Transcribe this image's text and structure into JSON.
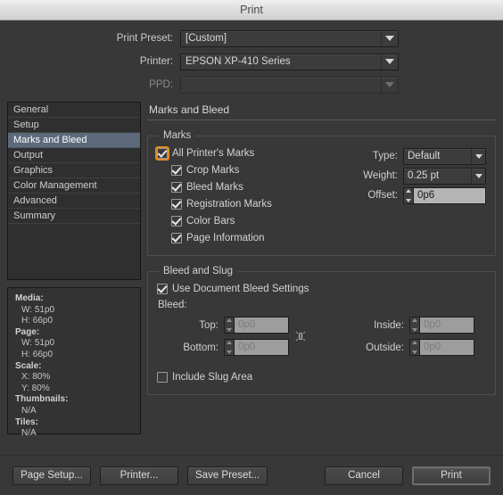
{
  "window": {
    "title": "Print"
  },
  "top_form": {
    "rows": [
      {
        "label": "Print Preset:",
        "value": "[Custom]",
        "disabled": false
      },
      {
        "label": "Printer:",
        "value": "EPSON XP-410 Series",
        "disabled": false
      },
      {
        "label": "PPD:",
        "value": "",
        "disabled": true
      }
    ]
  },
  "sidebar": {
    "items": [
      {
        "label": "General",
        "selected": false
      },
      {
        "label": "Setup",
        "selected": false
      },
      {
        "label": "Marks and Bleed",
        "selected": true
      },
      {
        "label": "Output",
        "selected": false
      },
      {
        "label": "Graphics",
        "selected": false
      },
      {
        "label": "Color Management",
        "selected": false
      },
      {
        "label": "Advanced",
        "selected": false
      },
      {
        "label": "Summary",
        "selected": false
      }
    ]
  },
  "info": {
    "media_key": "Media:",
    "media_w": "W: 51p0",
    "media_h": "H: 66p0",
    "page_key": "Page:",
    "page_w": "W: 51p0",
    "page_h": "H: 66p0",
    "scale_key": "Scale:",
    "scale_x": "X: 80%",
    "scale_y": "Y: 80%",
    "thumbnails_key": "Thumbnails:",
    "thumbnails_val": "N/A",
    "tiles_key": "Tiles:",
    "tiles_val": "N/A"
  },
  "panel": {
    "title": "Marks and Bleed",
    "marks": {
      "legend": "Marks",
      "all_printers_marks": {
        "label": "All Printer's Marks",
        "checked": true,
        "focused": true
      },
      "items": [
        {
          "label": "Crop Marks",
          "checked": true
        },
        {
          "label": "Bleed Marks",
          "checked": true
        },
        {
          "label": "Registration Marks",
          "checked": true
        },
        {
          "label": "Color Bars",
          "checked": true
        },
        {
          "label": "Page Information",
          "checked": true
        }
      ],
      "type_label": "Type:",
      "type_value": "Default",
      "weight_label": "Weight:",
      "weight_value": "0.25 pt",
      "offset_label": "Offset:",
      "offset_value": "0p6"
    },
    "bleed_slug": {
      "legend": "Bleed and Slug",
      "use_document_bleed": {
        "label": "Use Document Bleed Settings",
        "checked": true
      },
      "bleed_label": "Bleed:",
      "top_label": "Top:",
      "top_value": "0p0",
      "bottom_label": "Bottom:",
      "bottom_value": "0p0",
      "inside_label": "Inside:",
      "inside_value": "0p0",
      "outside_label": "Outside:",
      "outside_value": "0p0",
      "link_icon": "chain-link-icon",
      "include_slug": {
        "label": "Include Slug Area",
        "checked": false
      }
    }
  },
  "footer": {
    "page_setup": "Page Setup...",
    "printer": "Printer...",
    "save_preset": "Save Preset...",
    "cancel": "Cancel",
    "print": "Print"
  },
  "colors": {
    "window_bg": "#383838",
    "selection_blue": "#5c6a7c",
    "focus_orange": "#e08a22",
    "field_light": "#b4b4b4",
    "field_disabled": "#9d9d9d"
  }
}
